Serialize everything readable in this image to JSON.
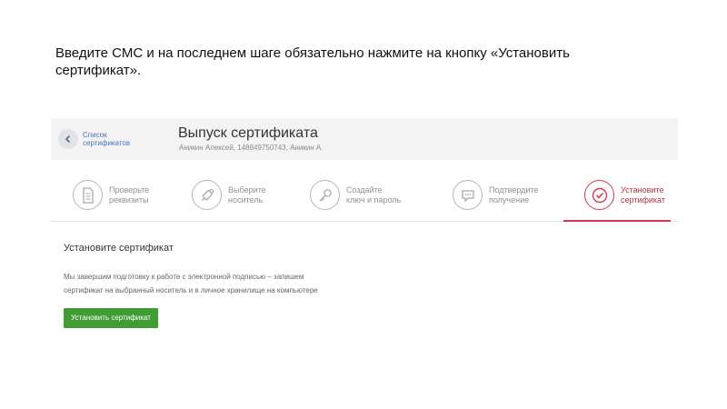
{
  "instruction": {
    "line1": "Введите СМС и на последнем шаге обязательно нажмите на кнопку «Установить",
    "line2": "сертификат»."
  },
  "header": {
    "back_line1": "Список",
    "back_line2": "сертификатов",
    "title": "Выпуск сертификата",
    "subtitle": "Аникин Алексей, 148849750743, Аникин А."
  },
  "steps": [
    {
      "line1": "Проверьте",
      "line2": "реквизиты",
      "icon": "document-icon",
      "active": false
    },
    {
      "line1": "Выберите",
      "line2": "носитель",
      "icon": "usb-token-icon",
      "active": false
    },
    {
      "line1": "Создайте",
      "line2": "ключ и пароль",
      "icon": "key-icon",
      "active": false
    },
    {
      "line1": "Подтвердите",
      "line2": "получение",
      "icon": "message-icon",
      "active": false
    },
    {
      "line1": "Установите",
      "line2": "сертификат",
      "icon": "check-icon",
      "active": true
    }
  ],
  "content": {
    "title": "Установите сертификат",
    "text_line1": "Мы завершим подготовку к работе с электронной подписью – запишем",
    "text_line2": "сертификат на выбранный носитель и в личное хранилище на компьютере",
    "button": "Установить сертификат"
  },
  "colors": {
    "accent_red": "#d9374b",
    "button_green": "#3f9d34",
    "link_blue": "#4a72c4"
  }
}
